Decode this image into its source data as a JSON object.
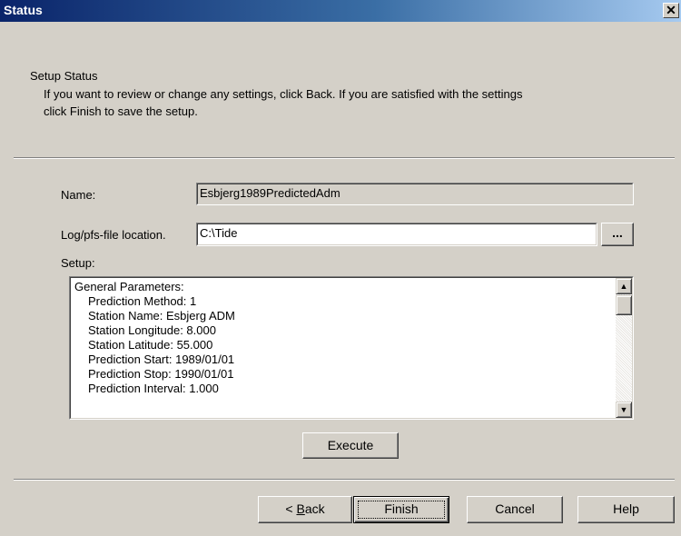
{
  "window": {
    "title": "Status",
    "close_glyph": "✕"
  },
  "header": {
    "heading": "Setup Status",
    "description_line1": "If you want to review or change any settings, click Back. If you are satisfied with the settings",
    "description_line2": "click Finish to save the setup."
  },
  "form": {
    "name_label": "Name:",
    "name_value": "Esbjerg1989PredictedAdm",
    "log_label": "Log/pfs-file location.",
    "log_value": "C:\\Tide",
    "browse_label": "...",
    "setup_label": "Setup:"
  },
  "setup_lines": [
    "General Parameters:",
    "Prediction Method:  1",
    "Station Name:  Esbjerg ADM",
    "Station Longitude:  8.000",
    "Station Latitude:  55.000",
    "Prediction Start:  1989/01/01",
    "Prediction Stop:  1990/01/01",
    "Prediction Interval:  1.000"
  ],
  "icons": {
    "scroll_up": "▲",
    "scroll_down": "▼"
  },
  "buttons": {
    "execute": "Execute",
    "back_prefix": "< ",
    "back_mnemonic": "B",
    "back_rest": "ack",
    "finish": "Finish",
    "cancel": "Cancel",
    "help": "Help"
  },
  "colors": {
    "title_start": "#0a246a",
    "title_end": "#a6caf0",
    "dialog_bg": "#d4d0c8"
  }
}
